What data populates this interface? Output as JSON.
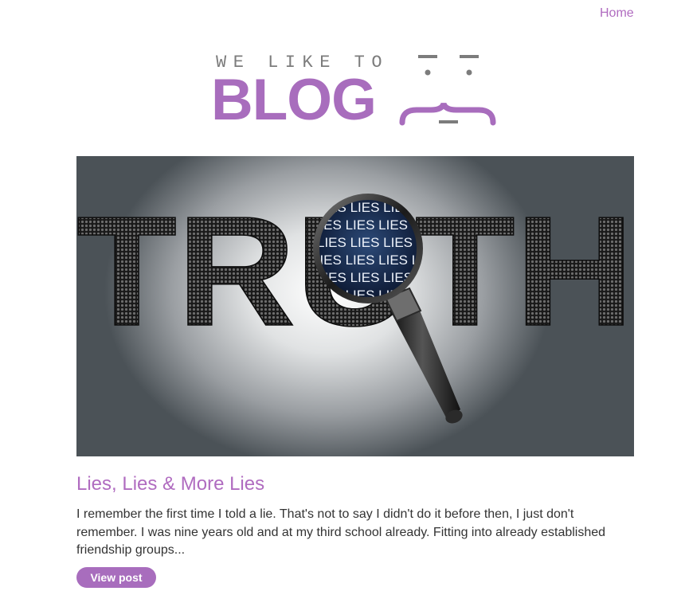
{
  "nav": {
    "home_label": "Home"
  },
  "logo": {
    "tagline": "WE LIKE TO",
    "word": "BLOG"
  },
  "colors": {
    "accent": "#a86dbd",
    "link": "#b06cc0",
    "text": "#333333",
    "tagline": "#7c7c7c"
  },
  "hero_image": {
    "big_word": "TRUTH",
    "magnified_word": "LIES"
  },
  "post": {
    "title": "Lies, Lies & More Lies",
    "excerpt": "I remember the first time I told a lie. That's not to say I didn't do it before then, I just don't remember. I was nine years old and at my third school already. Fitting into already established friendship groups...",
    "button_label": "View post"
  }
}
